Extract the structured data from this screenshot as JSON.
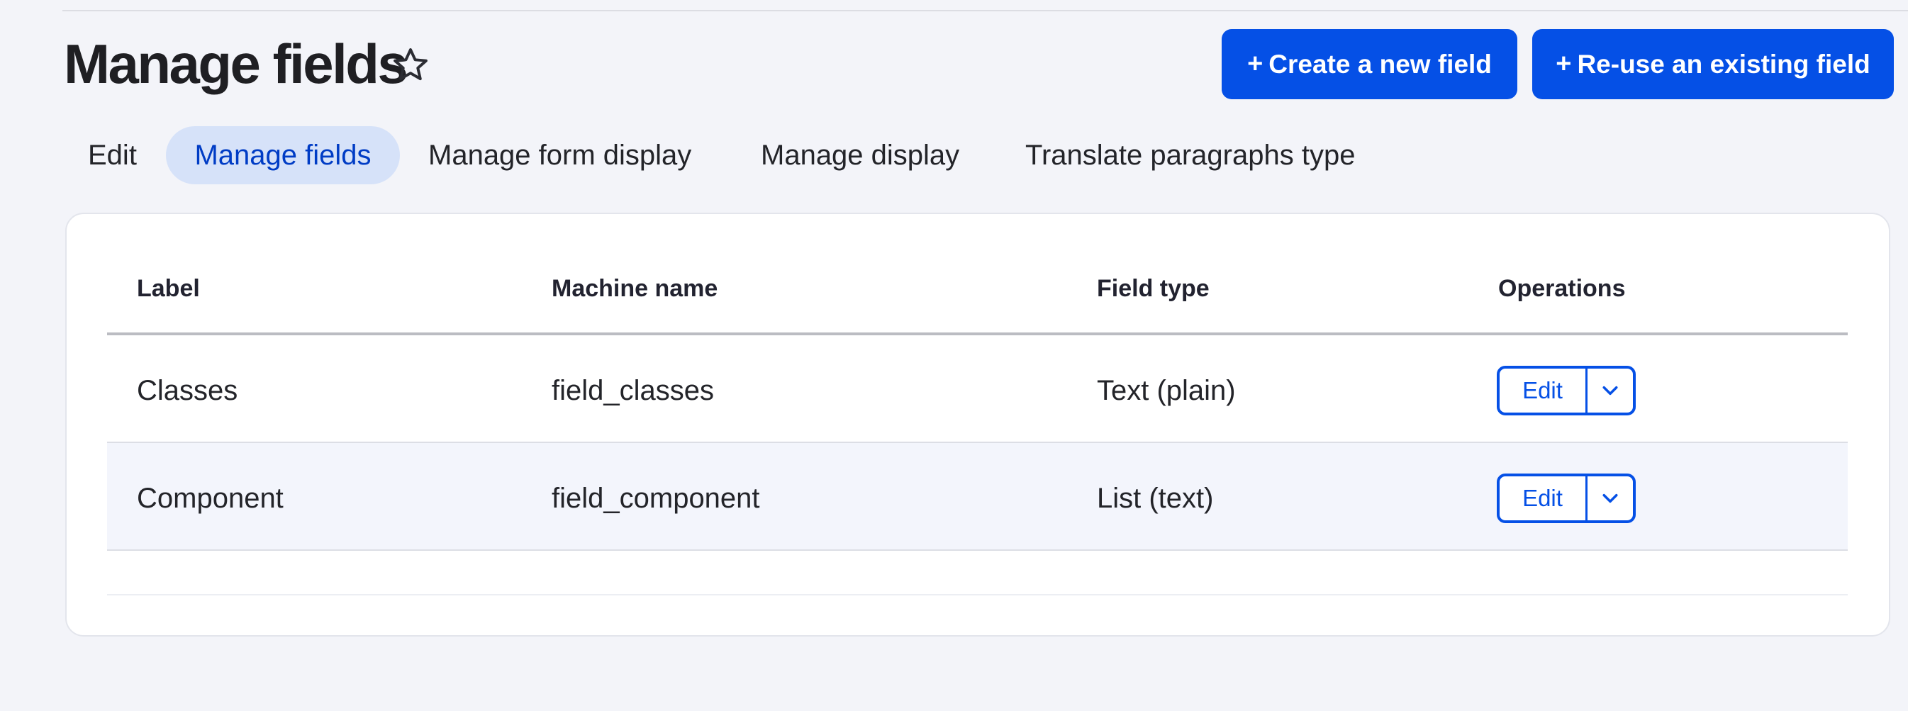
{
  "page": {
    "title": "Manage fields"
  },
  "actions": {
    "create_label": "Create a new field",
    "reuse_label": "Re-use an existing field",
    "plus_glyph": "+"
  },
  "tabs": [
    {
      "label": "Edit",
      "active": false
    },
    {
      "label": "Manage fields",
      "active": true
    },
    {
      "label": "Manage form display",
      "active": false
    },
    {
      "label": "Manage display",
      "active": false
    },
    {
      "label": "Translate paragraphs type",
      "active": false
    }
  ],
  "table": {
    "headers": [
      "Label",
      "Machine name",
      "Field type",
      "Operations"
    ],
    "rows": [
      {
        "label": "Classes",
        "machine_name": "field_classes",
        "field_type": "Text (plain)",
        "operation": "Edit"
      },
      {
        "label": "Component",
        "machine_name": "field_component",
        "field_type": "List (text)",
        "operation": "Edit"
      }
    ]
  },
  "icons": {
    "favorite": "star-outline-icon",
    "dropdown": "chevron-down-icon"
  },
  "colors": {
    "accent": "#0550e6",
    "active_tab_bg": "#d6e2f9",
    "active_tab_text": "#003cc5",
    "page_bg": "#f3f4f9"
  }
}
